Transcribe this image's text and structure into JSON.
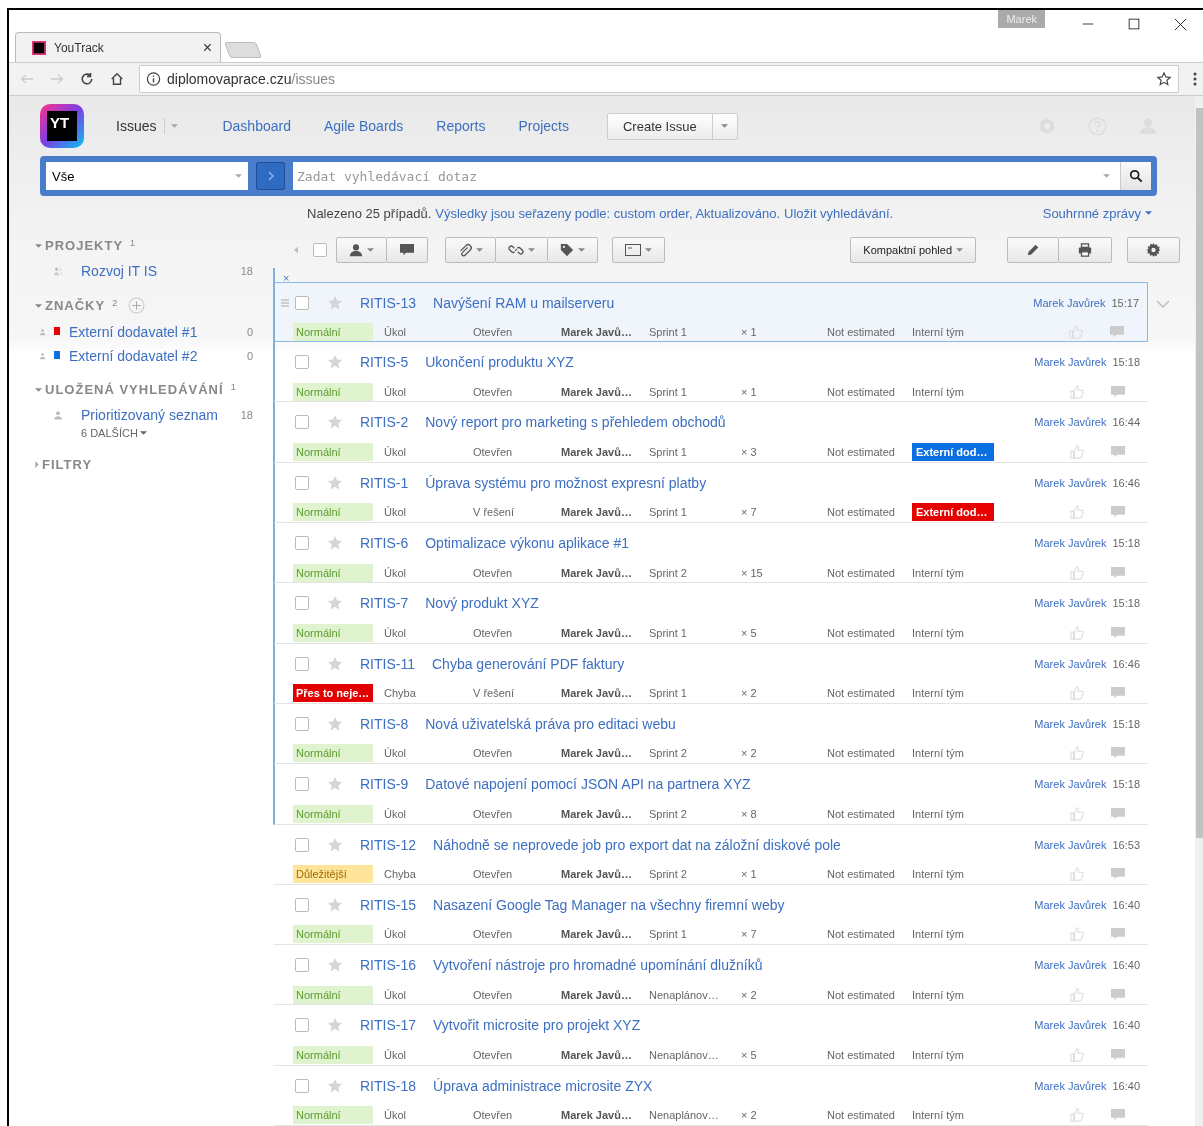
{
  "browser": {
    "tab_title": "YouTrack",
    "tab_close": "×",
    "profile": "Marek",
    "url_host": "diplomovaprace.czu",
    "url_path": "/issues"
  },
  "header": {
    "logo": "YT",
    "issues_menu": "Issues",
    "nav": [
      "Dashboard",
      "Agile Boards",
      "Reports",
      "Projects"
    ],
    "create_button": "Create Issue"
  },
  "search": {
    "context": "Vše",
    "placeholder": "Zadat vyhledávací dotaz"
  },
  "summary": {
    "count_text": "Nalezeno 25 případů.",
    "sort_link": "Výsledky jsou seřazeny podle: custom order, Aktualizováno.",
    "save_link": "Uložit vyhledávání.",
    "reports_link": "Souhrnné zprávy"
  },
  "sidebar": [
    {
      "title": "PROJEKTY",
      "count": "1",
      "expanded": true,
      "items": [
        {
          "label": "Rozvoj IT IS",
          "count": "18",
          "kind": "project"
        }
      ]
    },
    {
      "title": "ZNAČKY",
      "count": "2",
      "expanded": true,
      "add": true,
      "items": [
        {
          "label": "Externí dodavatel #1",
          "count": "0",
          "kind": "tag",
          "color": "#e60000"
        },
        {
          "label": "Externí dodavatel #2",
          "count": "0",
          "kind": "tag",
          "color": "#0a6fe0"
        }
      ]
    },
    {
      "title": "ULOŽENÁ VYHLEDÁVÁNÍ",
      "count": "1",
      "expanded": true,
      "items": [
        {
          "label": "Prioritizovaný seznam",
          "count": "18",
          "kind": "search"
        }
      ],
      "more": "6 DALŠÍCH"
    },
    {
      "title": "FILTRY",
      "expanded": false
    }
  ],
  "toolbar": {
    "select_all_checked": false,
    "view_button": "Kompaktní pohled",
    "clear": "×"
  },
  "issues": [
    {
      "id": "RITIS-13",
      "summary": "Navýšení RAM u mailserveru",
      "priority": {
        "text": "Normální",
        "kind": "normal"
      },
      "type": "Úkol",
      "state": "Otevřen",
      "assignee": "Marek Javů…",
      "sprint": "Sprint 1",
      "votes": "× 1",
      "estimate": "Not estimated",
      "team": {
        "text": "Interní tým"
      },
      "author": "Marek Javůrek",
      "time": "15:17",
      "selected": true,
      "marked": true
    },
    {
      "id": "RITIS-5",
      "summary": "Ukončení produktu XYZ",
      "priority": {
        "text": "Normální",
        "kind": "normal"
      },
      "type": "Úkol",
      "state": "Otevřen",
      "assignee": "Marek Javů…",
      "sprint": "Sprint 1",
      "votes": "× 1",
      "estimate": "Not estimated",
      "team": {
        "text": "Interní tým"
      },
      "author": "Marek Javůrek",
      "time": "15:18",
      "selected": false,
      "marked": true
    },
    {
      "id": "RITIS-2",
      "summary": "Nový report pro marketing s přehledem obchodů",
      "priority": {
        "text": "Normální",
        "kind": "normal"
      },
      "type": "Úkol",
      "state": "Otevřen",
      "assignee": "Marek Javů…",
      "sprint": "Sprint 1",
      "votes": "× 3",
      "estimate": "Not estimated",
      "team": {
        "text": "Externí dod…",
        "color": "#0a6fe0"
      },
      "author": "Marek Javůrek",
      "time": "16:44",
      "selected": false,
      "marked": true
    },
    {
      "id": "RITIS-1",
      "summary": "Úprava systému pro možnost expresní platby",
      "priority": {
        "text": "Normální",
        "kind": "normal"
      },
      "type": "Úkol",
      "state": "V řešení",
      "assignee": "Marek Javů…",
      "sprint": "Sprint 1",
      "votes": "× 7",
      "estimate": "Not estimated",
      "team": {
        "text": "Externí dod…",
        "color": "#e60000"
      },
      "author": "Marek Javůrek",
      "time": "16:46",
      "selected": false,
      "marked": true
    },
    {
      "id": "RITIS-6",
      "summary": "Optimalizace výkonu aplikace #1",
      "priority": {
        "text": "Normální",
        "kind": "normal"
      },
      "type": "Úkol",
      "state": "Otevřen",
      "assignee": "Marek Javů…",
      "sprint": "Sprint 2",
      "votes": "× 15",
      "estimate": "Not estimated",
      "team": {
        "text": "Interní tým"
      },
      "author": "Marek Javůrek",
      "time": "15:18",
      "selected": false,
      "marked": true
    },
    {
      "id": "RITIS-7",
      "summary": "Nový produkt XYZ",
      "priority": {
        "text": "Normální",
        "kind": "normal"
      },
      "type": "Úkol",
      "state": "Otevřen",
      "assignee": "Marek Javů…",
      "sprint": "Sprint 1",
      "votes": "× 5",
      "estimate": "Not estimated",
      "team": {
        "text": "Interní tým"
      },
      "author": "Marek Javůrek",
      "time": "15:18",
      "selected": false,
      "marked": true
    },
    {
      "id": "RITIS-11",
      "summary": "Chyba generování PDF faktury",
      "priority": {
        "text": "Přes to neje…",
        "kind": "critical"
      },
      "type": "Chyba",
      "state": "V řešení",
      "assignee": "Marek Javů…",
      "sprint": "Sprint 1",
      "votes": "× 2",
      "estimate": "Not estimated",
      "team": {
        "text": "Interní tým"
      },
      "author": "Marek Javůrek",
      "time": "16:46",
      "selected": false,
      "marked": true
    },
    {
      "id": "RITIS-8",
      "summary": "Nová uživatelská práva pro editaci webu",
      "priority": {
        "text": "Normální",
        "kind": "normal"
      },
      "type": "Úkol",
      "state": "Otevřen",
      "assignee": "Marek Javů…",
      "sprint": "Sprint 2",
      "votes": "× 2",
      "estimate": "Not estimated",
      "team": {
        "text": "Interní tým"
      },
      "author": "Marek Javůrek",
      "time": "15:18",
      "selected": false,
      "marked": true
    },
    {
      "id": "RITIS-9",
      "summary": "Datové napojení pomocí JSON API na partnera XYZ",
      "priority": {
        "text": "Normální",
        "kind": "normal"
      },
      "type": "Úkol",
      "state": "Otevřen",
      "assignee": "Marek Javů…",
      "sprint": "Sprint 2",
      "votes": "× 8",
      "estimate": "Not estimated",
      "team": {
        "text": "Interní tým"
      },
      "author": "Marek Javůrek",
      "time": "15:18",
      "selected": false,
      "marked": true
    },
    {
      "id": "RITIS-12",
      "summary": "Náhodně se neprovede job pro export dat na záložní diskové pole",
      "priority": {
        "text": "Důležitější",
        "kind": "major"
      },
      "type": "Chyba",
      "state": "Otevřen",
      "assignee": "Marek Javů…",
      "sprint": "Sprint 2",
      "votes": "× 1",
      "estimate": "Not estimated",
      "team": {
        "text": "Interní tým"
      },
      "author": "Marek Javůrek",
      "time": "16:53",
      "selected": false,
      "marked": false
    },
    {
      "id": "RITIS-15",
      "summary": "Nasazení Google Tag Manager na všechny firemní weby",
      "priority": {
        "text": "Normální",
        "kind": "normal"
      },
      "type": "Úkol",
      "state": "Otevřen",
      "assignee": "Marek Javů…",
      "sprint": "Sprint 1",
      "votes": "× 7",
      "estimate": "Not estimated",
      "team": {
        "text": "Interní tým"
      },
      "author": "Marek Javůrek",
      "time": "16:40",
      "selected": false,
      "marked": false
    },
    {
      "id": "RITIS-16",
      "summary": "Vytvoření nástroje pro hromadné upomínání dlužníků",
      "priority": {
        "text": "Normální",
        "kind": "normal"
      },
      "type": "Úkol",
      "state": "Otevřen",
      "assignee": "Marek Javů…",
      "sprint": "Nenaplánov…",
      "votes": "× 2",
      "estimate": "Not estimated",
      "team": {
        "text": "Interní tým"
      },
      "author": "Marek Javůrek",
      "time": "16:40",
      "selected": false,
      "marked": false
    },
    {
      "id": "RITIS-17",
      "summary": "Vytvořit microsite pro projekt XYZ",
      "priority": {
        "text": "Normální",
        "kind": "normal"
      },
      "type": "Úkol",
      "state": "Otevřen",
      "assignee": "Marek Javů…",
      "sprint": "Nenaplánov…",
      "votes": "× 5",
      "estimate": "Not estimated",
      "team": {
        "text": "Interní tým"
      },
      "author": "Marek Javůrek",
      "time": "16:40",
      "selected": false,
      "marked": false
    },
    {
      "id": "RITIS-18",
      "summary": "Úprava administrace microsite ZYX",
      "priority": {
        "text": "Normální",
        "kind": "normal"
      },
      "type": "Úkol",
      "state": "Otevřen",
      "assignee": "Marek Javů…",
      "sprint": "Nenaplánov…",
      "votes": "× 2",
      "estimate": "Not estimated",
      "team": {
        "text": "Interní tým"
      },
      "author": "Marek Javůrek",
      "time": "16:40",
      "selected": false,
      "marked": false
    }
  ]
}
